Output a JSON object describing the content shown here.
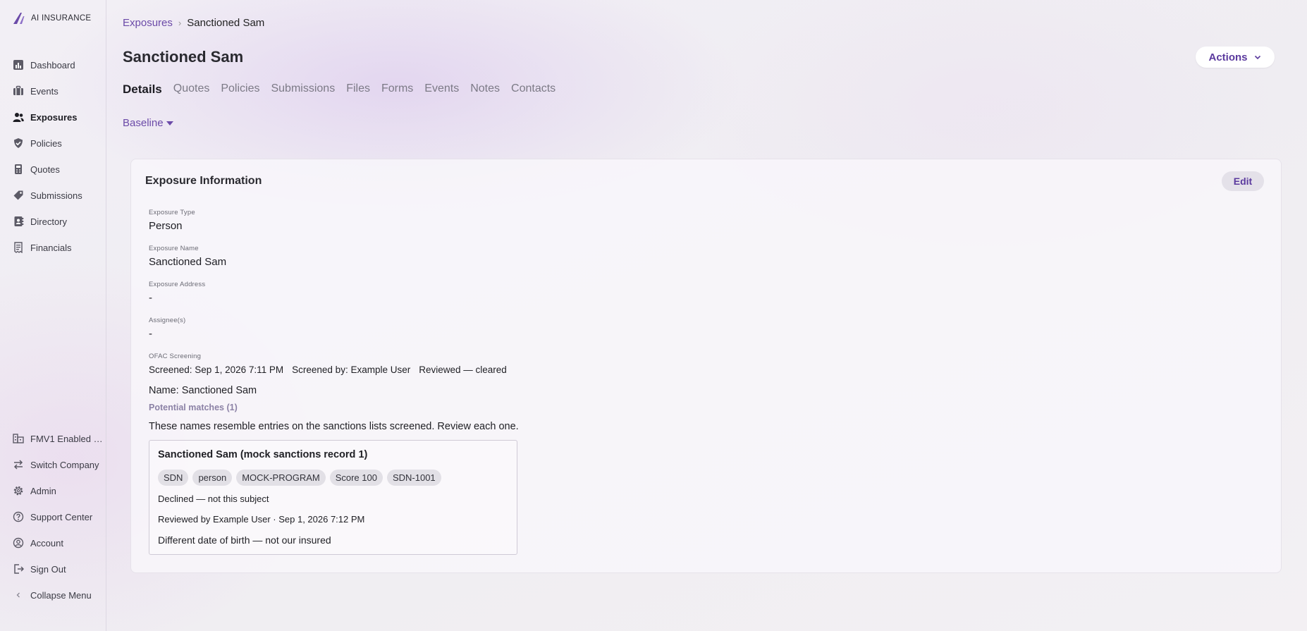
{
  "brand": {
    "name": "AI INSURANCE",
    "accent": "#6b4aa8"
  },
  "sidebar": {
    "items": [
      {
        "label": "Dashboard",
        "icon": "chart-icon"
      },
      {
        "label": "Events",
        "icon": "briefcase-icon"
      },
      {
        "label": "Exposures",
        "icon": "users-icon",
        "active": true
      },
      {
        "label": "Policies",
        "icon": "shield-check-icon"
      },
      {
        "label": "Quotes",
        "icon": "calculator-icon"
      },
      {
        "label": "Submissions",
        "icon": "tag-icon"
      },
      {
        "label": "Directory",
        "icon": "address-book-icon"
      },
      {
        "label": "Financials",
        "icon": "receipt-icon"
      }
    ],
    "bottom": [
      {
        "label": "FMV1 Enabled C...",
        "icon": "building-icon"
      },
      {
        "label": "Switch Company",
        "icon": "switch-icon"
      },
      {
        "label": "Admin",
        "icon": "gear-icon"
      },
      {
        "label": "Support Center",
        "icon": "help-icon"
      },
      {
        "label": "Account",
        "icon": "user-circle-icon"
      },
      {
        "label": "Sign Out",
        "icon": "sign-out-icon"
      },
      {
        "label": "Collapse Menu",
        "icon": "chevron-left-icon"
      }
    ]
  },
  "breadcrumb": {
    "parent": "Exposures",
    "current": "Sanctioned Sam"
  },
  "page": {
    "title": "Sanctioned Sam",
    "actions_label": "Actions"
  },
  "tabs": [
    "Details",
    "Quotes",
    "Policies",
    "Submissions",
    "Files",
    "Forms",
    "Events",
    "Notes",
    "Contacts"
  ],
  "baseline_label": "Baseline",
  "card": {
    "title": "Exposure Information",
    "edit_label": "Edit",
    "fields": {
      "type": {
        "label": "Exposure Type",
        "value": "Person"
      },
      "name": {
        "label": "Exposure Name",
        "value": "Sanctioned Sam"
      },
      "address": {
        "label": "Exposure Address",
        "value": "-"
      },
      "assignees": {
        "label": "Assignee(s)",
        "value": "-"
      }
    },
    "ofac": {
      "label": "OFAC Screening",
      "screened": "Screened: Sep 1, 2026 7:11 PM",
      "screened_by": "Screened by: Example User",
      "status": "Reviewed — cleared",
      "name_line": "Name: Sanctioned Sam",
      "potential_matches": "Potential matches (1)",
      "description": "These names resemble entries on the sanctions lists screened. Review each one.",
      "match": {
        "title": "Sanctioned Sam (mock sanctions record 1)",
        "chips": [
          "SDN",
          "person",
          "MOCK-PROGRAM",
          "Score 100",
          "SDN-1001"
        ],
        "decision": "Declined — not this subject",
        "reviewed": "Reviewed by Example User · Sep 1, 2026 7:12 PM",
        "note": "Different date of birth — not our insured"
      }
    }
  }
}
